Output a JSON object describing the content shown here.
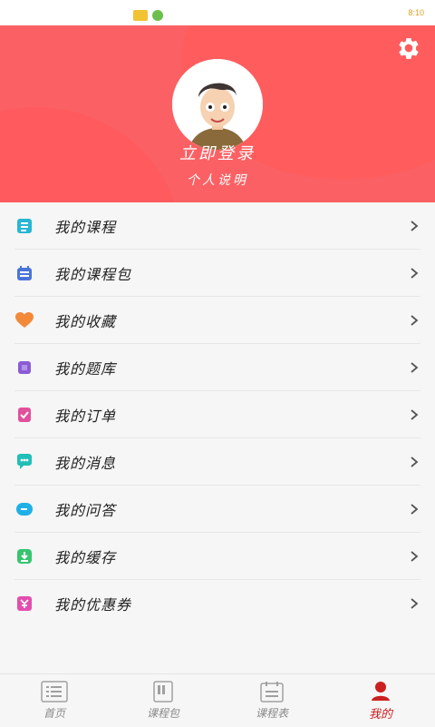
{
  "status_bar": {
    "right_text": "8:10"
  },
  "header": {
    "login_label": "立即登录",
    "description": "个人说明"
  },
  "menu": [
    {
      "label": "我的课程",
      "icon": "course-list-icon",
      "color": "#27b6d3"
    },
    {
      "label": "我的课程包",
      "icon": "calendar-icon",
      "color": "#4a74d8"
    },
    {
      "label": "我的收藏",
      "icon": "heart-icon",
      "color": "#f28a3a"
    },
    {
      "label": "我的题库",
      "icon": "question-bank-icon",
      "color": "#8b5bd6"
    },
    {
      "label": "我的订单",
      "icon": "order-icon",
      "color": "#e0509b"
    },
    {
      "label": "我的消息",
      "icon": "message-icon",
      "color": "#22bfb6"
    },
    {
      "label": "我的问答",
      "icon": "qa-icon",
      "color": "#1fb0e6"
    },
    {
      "label": "我的缓存",
      "icon": "download-icon",
      "color": "#37c46e"
    },
    {
      "label": "我的优惠券",
      "icon": "coupon-icon",
      "color": "#e24eb0"
    }
  ],
  "tabbar": {
    "tabs": [
      {
        "label": "首页"
      },
      {
        "label": "课程包"
      },
      {
        "label": "课程表"
      },
      {
        "label": "我的"
      }
    ],
    "active_color": "#cc1f1f"
  }
}
